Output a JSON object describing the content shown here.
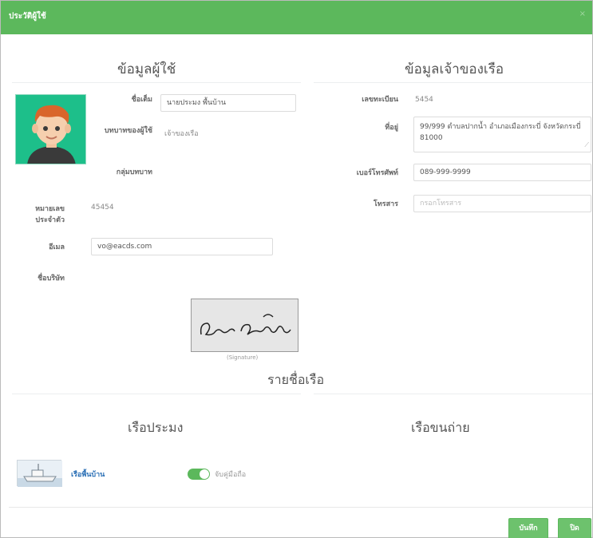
{
  "modal": {
    "title": "ประวัติผู้ใช้",
    "close_label": "×"
  },
  "user_info": {
    "heading": "ข้อมูลผู้ใช้",
    "first_name_label": "ชื่อเต็ม",
    "first_name_value": "นายประมง พื้นบ้าน",
    "role_label": "บทบาทของผู้ใช้",
    "role_value": "เจ้าของเรือ",
    "role_group_label": "กลุ่มบทบาท",
    "id_card_label": "หมายเลขประจำตัว",
    "id_card_value": "45454",
    "email_label": "อีเมล",
    "email_value": "vo@eacds.com",
    "company_label": "ชื่อบริษัท",
    "signature_caption": "(Signature)"
  },
  "owner_info": {
    "heading": "ข้อมูลเจ้าของเรือ",
    "reg_label": "เลขทะเบียน",
    "reg_value": "5454",
    "address_label": "ที่อยู่",
    "address_value": "99/999 ตำบลปากน้ำ อำเภอเมืองกระบี่ จังหวัดกระบี่ 81000",
    "phone_label": "เบอร์โทรศัพท์",
    "phone_value": "089-999-9999",
    "fax_label": "โทรสาร",
    "fax_placeholder": "กรอกโทรสาร"
  },
  "ship_list": {
    "heading": "รายชื่อเรือ",
    "fishing_heading": "เรือประมง",
    "transfer_heading": "เรือขนถ่าย",
    "ship_name": "เรือพื้นบ้าน",
    "toggle_label": "จับคู่มือถือ",
    "toggle_on": true
  },
  "footer": {
    "save_label": "บันทึก",
    "close_label": "ปิด"
  },
  "colors": {
    "header": "#5cb85c",
    "button": "#6dc26d",
    "link": "#2a6fb5",
    "avatar_bg": "#1dbf8a"
  }
}
